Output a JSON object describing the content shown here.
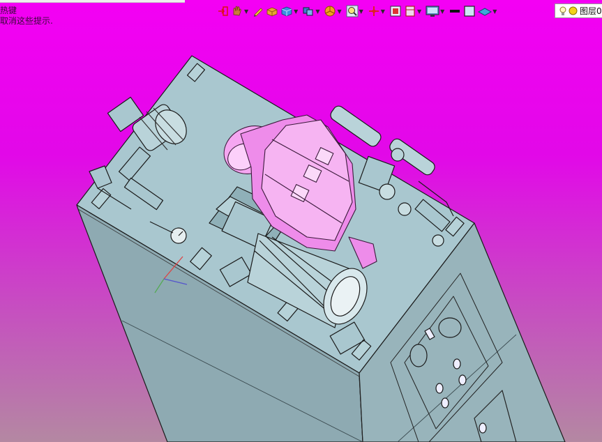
{
  "hint": {
    "line1": "热键",
    "line2": "取消这些提示."
  },
  "toolbar": {
    "icons": [
      "exit-arrow-icon",
      "hand-pan-icon",
      "pen-sketch-icon",
      "box-solid-icon",
      "cube-view-icon",
      "layers-view-icon",
      "pie-render-icon",
      "zoom-search-icon",
      "axis-cross-icon",
      "fit-frame-icon",
      "section-box-icon",
      "monitor-display-icon",
      "black-line-icon",
      "square-color-icon",
      "plane-layer-icon"
    ]
  },
  "layer": {
    "label": "图层0"
  },
  "colors": {
    "background_top": "#f400f4",
    "background_bottom": "#b488a2",
    "model_face": "#a9c7cf",
    "model_dark": "#7e9ea6",
    "pump_pink": "#f090ee"
  }
}
